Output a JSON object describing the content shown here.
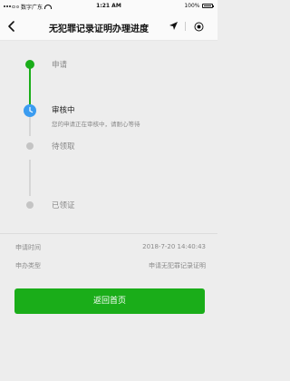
{
  "status_bar": {
    "carrier": "数字广东",
    "time": "1:21 AM",
    "battery": "100%"
  },
  "nav": {
    "title": "无犯罪记录证明办理进度",
    "back_icon": "chevron-left-icon",
    "location_icon": "location-arrow-icon",
    "capsule_icon": "target-icon"
  },
  "colors": {
    "accent_green": "#1aad19",
    "active_blue": "#3b9cf0",
    "inactive_gray": "#c4c4c4"
  },
  "steps": [
    {
      "label": "申请",
      "state": "done"
    },
    {
      "label": "审核中",
      "sub": "您的申请正在审核中，请耐心等待",
      "state": "current",
      "icon": "clock-icon"
    },
    {
      "label": "待领取",
      "state": "pending"
    },
    {
      "label": "已领证",
      "state": "pending"
    }
  ],
  "info": {
    "rows": [
      {
        "label": "申请时间",
        "value": "2018-7-20 14:40:43"
      },
      {
        "label": "申办类型",
        "value": "申请无犯罪记录证明"
      }
    ]
  },
  "actions": {
    "home_button": "返回首页"
  }
}
